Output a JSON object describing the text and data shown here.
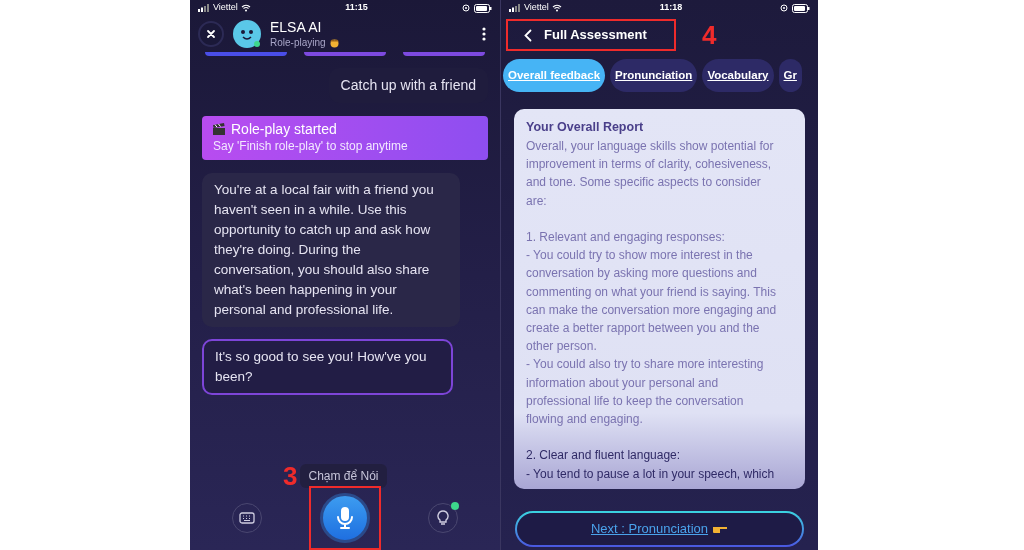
{
  "left_screen": {
    "status_bar": {
      "carrier": "Viettel",
      "time": "11:15"
    },
    "header": {
      "title": "ELSA AI",
      "subtitle": "Role-playing"
    },
    "messages": [
      {
        "kind": "user",
        "text": "Catch up with a friend"
      },
      {
        "kind": "banner",
        "title": "Role-play started",
        "subtitle": "Say 'Finish role-play' to stop anytime"
      },
      {
        "kind": "assistant",
        "text": "You're at a local fair with a friend you\nhaven't seen in a while. Use this\nopportunity to catch up and ask how\nthey're doing. During the\nconversation, you should also share\nwhat's been happening in your\npersonal and professional life."
      },
      {
        "kind": "reply",
        "text": "It's so good to see you! How've you\nbeen?"
      }
    ],
    "mic_tooltip": "Chạm để Nói",
    "annotation": "3"
  },
  "right_screen": {
    "status_bar": {
      "carrier": "Viettel",
      "time": "11:18"
    },
    "header": {
      "title": "Full Assessment"
    },
    "annotation": "4",
    "tabs": [
      {
        "label": "Overall feedback",
        "selected": true
      },
      {
        "label": "Pronunciation",
        "selected": false
      },
      {
        "label": "Vocabulary",
        "selected": false
      },
      {
        "label": "Gr",
        "selected": false
      }
    ],
    "report": {
      "title": "Your Overall Report",
      "paragraphs": [
        "Overall, your language skills show potential for\nimprovement in terms of clarity, cohesiveness,\nand tone. Some specific aspects to consider\nare:",
        "1. Relevant and engaging responses:\n- You could try to show more interest in the\nconversation by asking more questions and\ncommenting on what your friend is saying. This\ncan make the conversation more engaging and\ncreate a better rapport between you and the\nother person.\n- You could also try to share more interesting\ninformation about your personal and\nprofessional life to keep the conversation\nflowing and engaging.",
        "2. Clear and fluent language:\n- You tend to pause a lot in your speech, which"
      ]
    },
    "next_button": "Next : Pronunciation"
  }
}
